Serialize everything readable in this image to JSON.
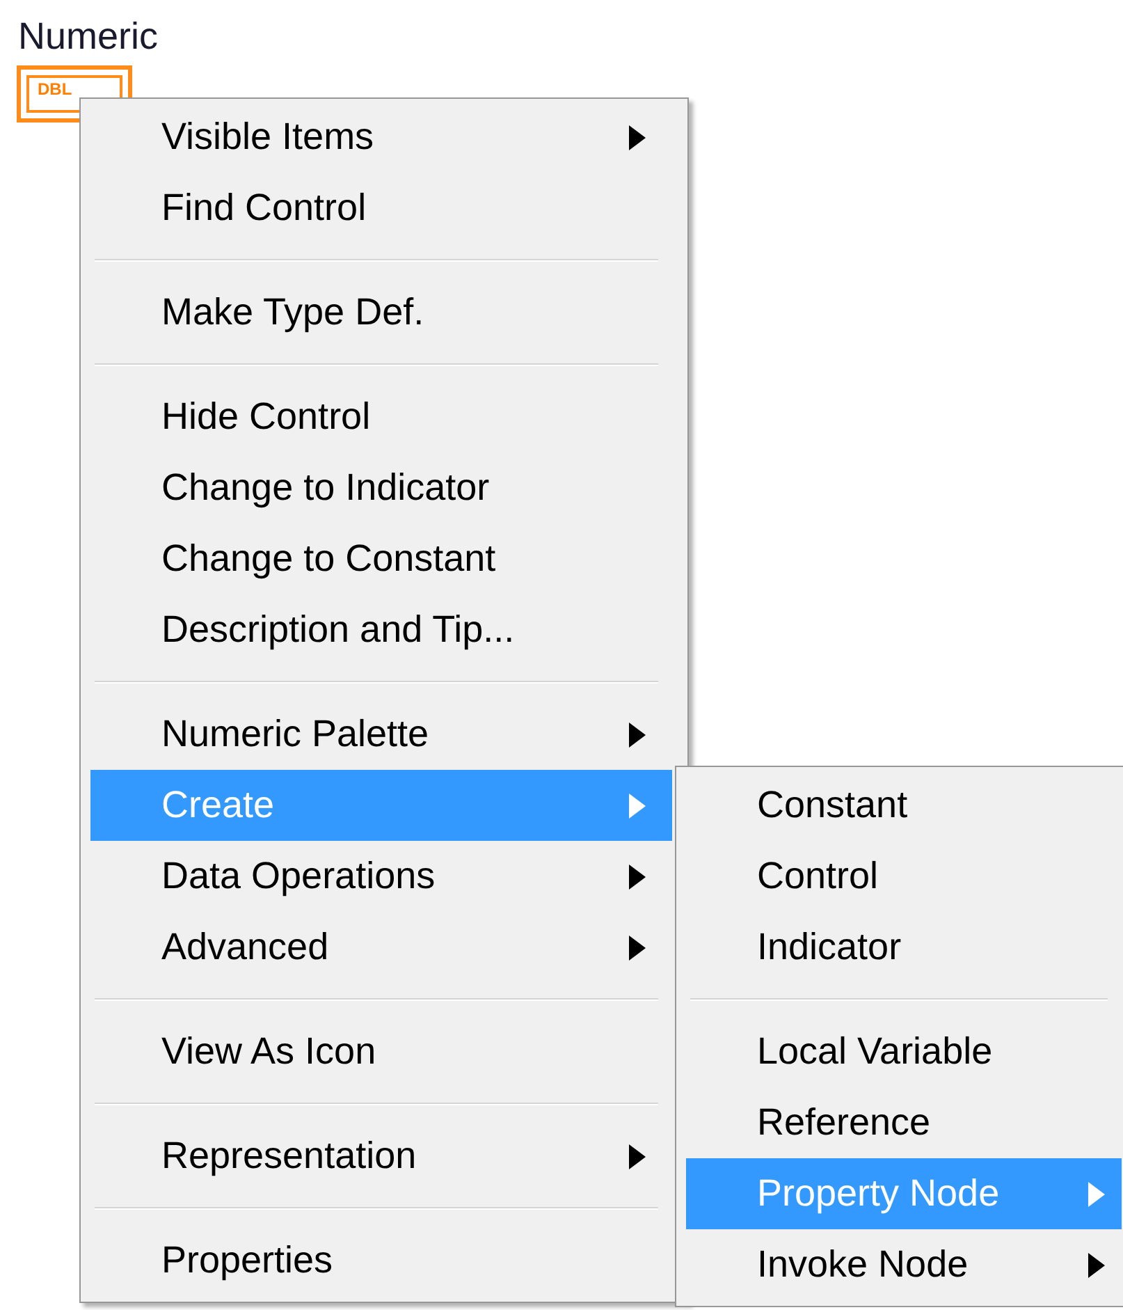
{
  "control": {
    "label": "Numeric",
    "terminal": "DBL"
  },
  "menu": [
    {
      "kind": "item",
      "label": "Visible Items",
      "submenu": true,
      "selected": false
    },
    {
      "kind": "item",
      "label": "Find Control",
      "submenu": false,
      "selected": false
    },
    {
      "kind": "separator"
    },
    {
      "kind": "item",
      "label": "Make Type Def.",
      "submenu": false,
      "selected": false
    },
    {
      "kind": "separator"
    },
    {
      "kind": "item",
      "label": "Hide Control",
      "submenu": false,
      "selected": false
    },
    {
      "kind": "item",
      "label": "Change to Indicator",
      "submenu": false,
      "selected": false
    },
    {
      "kind": "item",
      "label": "Change to Constant",
      "submenu": false,
      "selected": false
    },
    {
      "kind": "item",
      "label": "Description and Tip...",
      "submenu": false,
      "selected": false
    },
    {
      "kind": "separator"
    },
    {
      "kind": "item",
      "label": "Numeric Palette",
      "submenu": true,
      "selected": false
    },
    {
      "kind": "item",
      "label": "Create",
      "submenu": true,
      "selected": true
    },
    {
      "kind": "item",
      "label": "Data Operations",
      "submenu": true,
      "selected": false
    },
    {
      "kind": "item",
      "label": "Advanced",
      "submenu": true,
      "selected": false
    },
    {
      "kind": "separator"
    },
    {
      "kind": "item",
      "label": "View As Icon",
      "submenu": false,
      "selected": false
    },
    {
      "kind": "separator"
    },
    {
      "kind": "item",
      "label": "Representation",
      "submenu": true,
      "selected": false
    },
    {
      "kind": "separator"
    },
    {
      "kind": "item",
      "label": "Properties",
      "submenu": false,
      "selected": false
    }
  ],
  "submenu": [
    {
      "kind": "item",
      "label": "Constant",
      "submenu": false,
      "selected": false
    },
    {
      "kind": "item",
      "label": "Control",
      "submenu": false,
      "selected": false
    },
    {
      "kind": "item",
      "label": "Indicator",
      "submenu": false,
      "selected": false
    },
    {
      "kind": "separator"
    },
    {
      "kind": "item",
      "label": "Local Variable",
      "submenu": false,
      "selected": false
    },
    {
      "kind": "item",
      "label": "Reference",
      "submenu": false,
      "selected": false
    },
    {
      "kind": "item",
      "label": "Property Node",
      "submenu": true,
      "selected": true
    },
    {
      "kind": "item",
      "label": "Invoke Node",
      "submenu": true,
      "selected": false
    }
  ]
}
